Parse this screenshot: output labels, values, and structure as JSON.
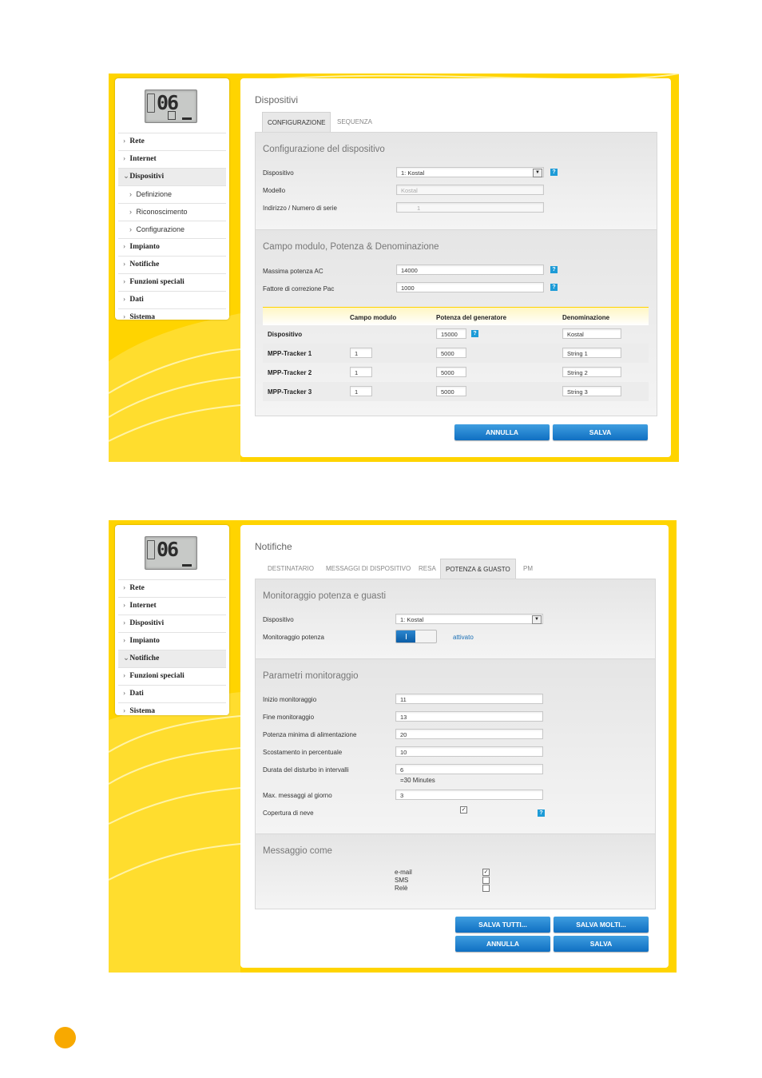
{
  "brand_colors": {
    "yellow": "#ffd400",
    "button_blue": "#1570c4",
    "help_blue": "#1d9bd7",
    "orange_dot": "#f8a900"
  },
  "screen1": {
    "lcd": "06",
    "nav": [
      "Rete",
      "Internet",
      "Dispositivi",
      "Definizione",
      "Riconoscimento",
      "Configurazione",
      "Impianto",
      "Notifiche",
      "Funzioni speciali",
      "Dati",
      "Sistema"
    ],
    "title": "Dispositivi",
    "tabs": [
      "CONFIGURAZIONE",
      "SEQUENZA"
    ],
    "section1": {
      "title": "Configurazione del dispositivo",
      "dispositivo_label": "Dispositivo",
      "dispositivo_value": "1: Kostal",
      "modello_label": "Modello",
      "modello_value": "Kostal",
      "indirizzo_label": "Indirizzo / Numero di serie",
      "indirizzo_value": "1"
    },
    "section2": {
      "title": "Campo modulo, Potenza & Denominazione",
      "massima_label": "Massima potenza AC",
      "massima_value": "14000",
      "fattore_label": "Fattore di correzione Pac",
      "fattore_value": "1000"
    },
    "table": {
      "headers": [
        "Campo modulo",
        "Potenza del generatore",
        "Denominazione"
      ],
      "rows": [
        {
          "label": "Dispositivo",
          "campo": "",
          "potenza": "15000",
          "nome": "Kostal"
        },
        {
          "label": "MPP-Tracker 1",
          "campo": "1",
          "potenza": "5000",
          "nome": "String 1"
        },
        {
          "label": "MPP-Tracker 2",
          "campo": "1",
          "potenza": "5000",
          "nome": "String 2"
        },
        {
          "label": "MPP-Tracker 3",
          "campo": "1",
          "potenza": "5000",
          "nome": "String 3"
        }
      ]
    },
    "help": "?",
    "buttons": {
      "cancel": "ANNULLA",
      "save": "SALVA"
    }
  },
  "screen2": {
    "lcd": "06",
    "nav": [
      "Rete",
      "Internet",
      "Dispositivi",
      "Impianto",
      "Notifiche",
      "Funzioni speciali",
      "Dati",
      "Sistema"
    ],
    "title": "Notifiche",
    "tabs": [
      "DESTINATARIO",
      "MESSAGGI DI DISPOSITIVO",
      "RESA",
      "POTENZA & GUASTO",
      "PM"
    ],
    "section1": {
      "title": "Monitoraggio potenza e guasti",
      "dispositivo_label": "Dispositivo",
      "dispositivo_value": "1: Kostal",
      "monitor_label": "Monitoraggio potenza",
      "monitor_state": "attivato",
      "monitor_on": true
    },
    "section2": {
      "title": "Parametri monitoraggio",
      "fields": [
        {
          "label": "Inizio monitoraggio",
          "value": "11"
        },
        {
          "label": "Fine monitoraggio",
          "value": "13"
        },
        {
          "label": "Potenza minima di alimentazione",
          "value": "20"
        },
        {
          "label": "Scostamento in percentuale",
          "value": "10"
        },
        {
          "label": "Durata del disturbo in intervalli",
          "value": "6"
        },
        {
          "label": "Max. messaggi al giorno",
          "value": "3"
        }
      ],
      "duration_note": "=30 Minutes",
      "neve_label": "Copertura di neve",
      "neve_checked": true
    },
    "section3": {
      "title": "Messaggio come",
      "options": [
        {
          "label": "e-mail",
          "checked": true
        },
        {
          "label": "SMS",
          "checked": false
        },
        {
          "label": "Relè",
          "checked": false
        }
      ]
    },
    "help": "?",
    "buttons": {
      "save_all": "SALVA TUTTI...",
      "save_many": "SALVA MOLTI...",
      "cancel": "ANNULLA",
      "save": "SALVA"
    }
  }
}
